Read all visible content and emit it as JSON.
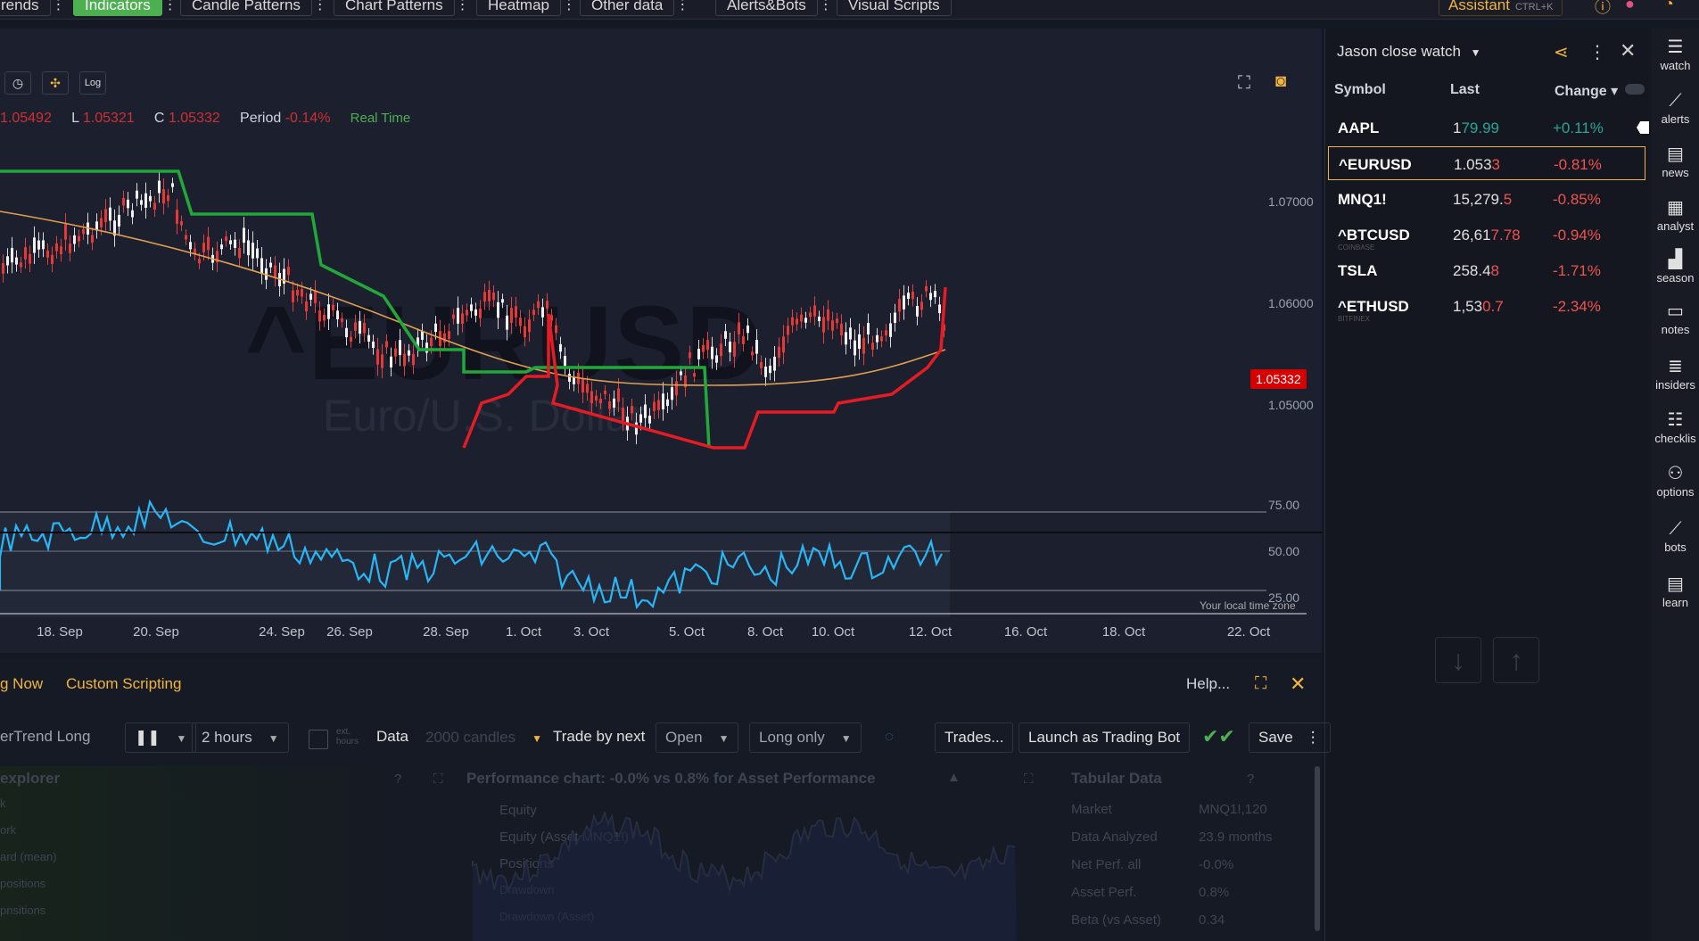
{
  "topbar": {
    "tabs": [
      "rends",
      "Indicators",
      "Candle Patterns",
      "Chart Patterns",
      "Heatmap",
      "Other data",
      "Alerts&Bots",
      "Visual Scripts"
    ],
    "assistant": "Assistant",
    "assistant_shortcut": "CTRL+K"
  },
  "chart": {
    "tools": [
      "◷",
      "✣",
      "Log"
    ],
    "ohlc": {
      "l_key": "L",
      "l_val": "1.05321",
      "c_key": "C",
      "c_val": "1.05332",
      "h_val": "1.05492",
      "period_key": "Period",
      "period_val": "-0.14%",
      "realtime": "Real Time"
    },
    "symbol": "^EURUSD",
    "symbol_desc": "Euro/U.S. Dollar",
    "y_labels": [
      "1.07000",
      "1.06000",
      "1.05000"
    ],
    "last_price": "1.05332",
    "osc_labels": [
      "75.00",
      "50.00",
      "25.00"
    ],
    "timezone_note": "Your local time zone",
    "x_labels": [
      "18. Sep",
      "20. Sep",
      "24. Sep",
      "26. Sep",
      "28. Sep",
      "1. Oct",
      "3. Oct",
      "5. Oct",
      "8. Oct",
      "10. Oct",
      "12. Oct",
      "16. Oct",
      "18. Oct",
      "22. Oct"
    ]
  },
  "watchlist": {
    "title": "Jason close watch",
    "headers": {
      "symbol": "Symbol",
      "last": "Last",
      "change": "Change ▾"
    },
    "rows": [
      {
        "symbol": "AAPL",
        "sub": "",
        "last_a": "1",
        "last_b": "79.99",
        "change": "+0.11%",
        "color": "#26a69a"
      },
      {
        "symbol": "^EURUSD",
        "sub": "",
        "last_a": "1.053",
        "last_b": "3",
        "change": "-0.81%",
        "color": "#ef5350"
      },
      {
        "symbol": "MNQ1!",
        "sub": "",
        "last_a": "15,279.",
        "last_b": "5",
        "change": "-0.85%",
        "color": "#ef5350"
      },
      {
        "symbol": "^BTCUSD",
        "sub": "COINBASE",
        "last_a": "26,61",
        "last_b": "7.78",
        "change": "-0.94%",
        "color": "#ef5350"
      },
      {
        "symbol": "TSLA",
        "sub": "",
        "last_a": "258.4",
        "last_b": "8",
        "change": "-1.71%",
        "color": "#ef5350"
      },
      {
        "symbol": "^ETHUSD",
        "sub": "BITFINEX",
        "last_a": "1,53",
        "last_b": "0.7",
        "change": "-2.34%",
        "color": "#ef5350"
      }
    ]
  },
  "rail": {
    "items": [
      {
        "label": "watch",
        "icon": "list-icon",
        "glyph": "☰"
      },
      {
        "label": "alerts",
        "icon": "alerts-icon",
        "glyph": "⟋"
      },
      {
        "label": "news",
        "icon": "news-icon",
        "glyph": "▤"
      },
      {
        "label": "analyst",
        "icon": "analyst-icon",
        "glyph": "▦"
      },
      {
        "label": "season",
        "icon": "season-icon",
        "glyph": "▟"
      },
      {
        "label": "notes",
        "icon": "notes-icon",
        "glyph": "▭"
      },
      {
        "label": "insiders",
        "icon": "insiders-icon",
        "glyph": "≣"
      },
      {
        "label": "checklis",
        "icon": "checklist-icon",
        "glyph": "☷"
      },
      {
        "label": "options",
        "icon": "options-icon",
        "glyph": "⚇"
      },
      {
        "label": "bots",
        "icon": "bots-icon",
        "glyph": "⟋"
      },
      {
        "label": "learn",
        "icon": "learn-icon",
        "glyph": "▤"
      }
    ]
  },
  "bottom": {
    "tabs": [
      "g Now",
      "Custom Scripting"
    ],
    "help": "Help...",
    "strategy": "erTrend Long",
    "interval": "2 hours",
    "ext_hours": "ext. hours",
    "data_label": "Data",
    "data_value": "2000 candles",
    "trade_by_label": "Trade by next",
    "trade_by_value": "Open",
    "direction": "Long only",
    "trades_btn": "Trades...",
    "launch_btn": "Launch as Trading Bot",
    "save_btn": "Save",
    "explorer_title": "explorer",
    "perf_title": "Performance chart: -0.0% vs 0.8% for Asset Performance",
    "legend": [
      "Equity",
      "Equity (Asset MNQ1!)",
      "Positions",
      "Drawdown",
      "Drawdown (Asset)"
    ],
    "tabular_title": "Tabular Data",
    "tabular": [
      {
        "k": "Market",
        "v": "MNQ1!,120"
      },
      {
        "k": "Data Analyzed",
        "v": "23.9 months"
      },
      {
        "k": "Net Perf. all",
        "v": "-0.0%"
      },
      {
        "k": "Asset Perf.",
        "v": "0.8%"
      },
      {
        "k": "Beta (vs Asset)",
        "v": "0.34"
      }
    ],
    "explorer_rows": [
      "k",
      "ork",
      "ard (mean)",
      "positions",
      "pnsitions"
    ]
  }
}
